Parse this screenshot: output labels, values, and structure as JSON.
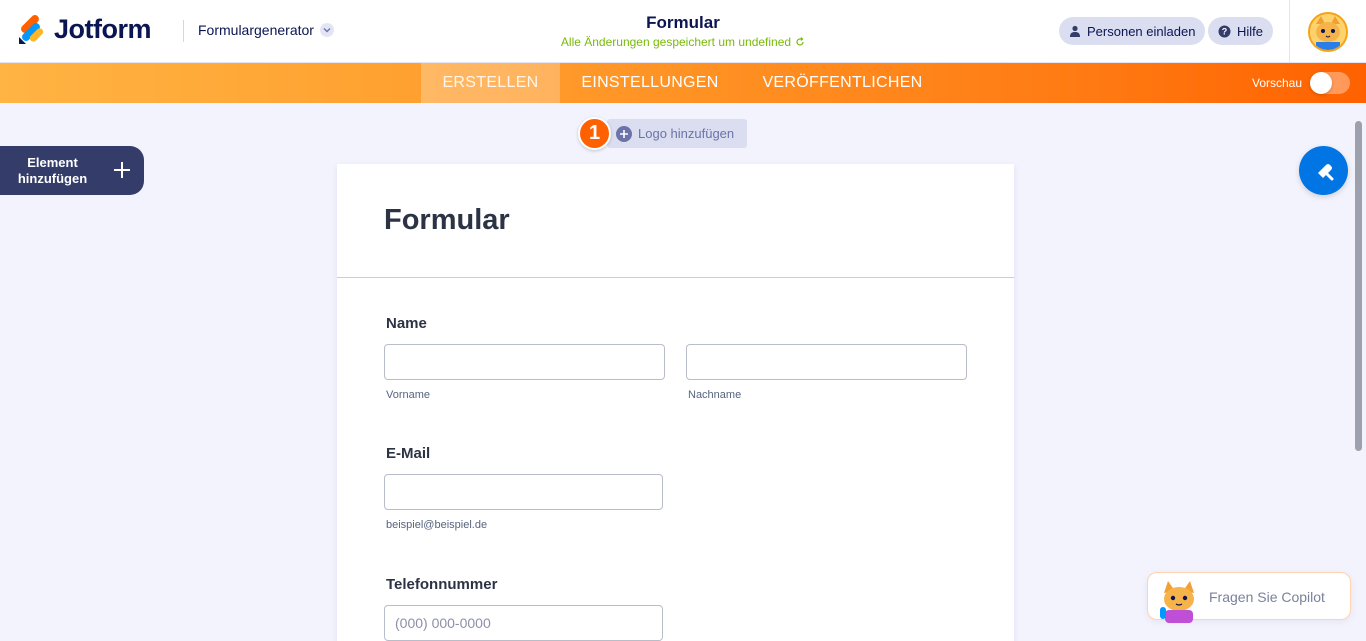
{
  "header": {
    "brand": "Jotform",
    "generator_label": "Formulargenerator",
    "form_title": "Formular",
    "saved_status": "Alle Änderungen gespeichert um undefined",
    "invite_label": "Personen einladen",
    "help_label": "Hilfe"
  },
  "nav": {
    "tabs": [
      {
        "label": "ERSTELLEN",
        "active": true
      },
      {
        "label": "EINSTELLUNGEN",
        "active": false
      },
      {
        "label": "VERÖFFENTLICHEN",
        "active": false
      }
    ],
    "preview_label": "Vorschau",
    "preview_on": false
  },
  "sidebar": {
    "add_element_label": "Element hinzufügen"
  },
  "builder": {
    "step_number": "1",
    "add_logo_label": "Logo hinzufügen"
  },
  "form": {
    "title": "Formular",
    "name_label": "Name",
    "first_name_sublabel": "Vorname",
    "last_name_sublabel": "Nachname",
    "email_label": "E-Mail",
    "email_sublabel": "beispiel@beispiel.de",
    "phone_label": "Telefonnummer",
    "phone_placeholder": "(000) 000-0000"
  },
  "copilot": {
    "label": "Fragen Sie Copilot"
  },
  "colors": {
    "brand_dark": "#0a1551",
    "orange": "#ff6100",
    "saved_green": "#78bb07",
    "blue": "#0075e3"
  }
}
